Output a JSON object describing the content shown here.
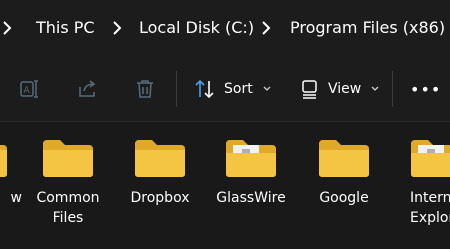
{
  "breadcrumb": {
    "items": [
      {
        "label": "This PC"
      },
      {
        "label": "Local Disk (C:)"
      },
      {
        "label": "Program Files (x86)"
      }
    ]
  },
  "toolbar": {
    "sort_label": "Sort",
    "view_label": "View",
    "more_label": "•••"
  },
  "items": [
    {
      "label": "w",
      "icon": "folder-icon"
    },
    {
      "label": "Common Files",
      "line1": "Common",
      "line2": "Files",
      "icon": "folder-icon"
    },
    {
      "label": "Dropbox",
      "icon": "folder-icon"
    },
    {
      "label": "GlassWire",
      "icon": "folder-app-icon"
    },
    {
      "label": "Google",
      "icon": "folder-icon"
    },
    {
      "label": "Internet Explorer",
      "line1": "Interne",
      "line2": "Explor",
      "icon": "folder-app-icon"
    }
  ],
  "colors": {
    "background": "#191919",
    "folder": "#f4c542",
    "folder_back": "#e0a92a",
    "text": "#ffffff",
    "disabled_icon": "#5a6a78"
  }
}
